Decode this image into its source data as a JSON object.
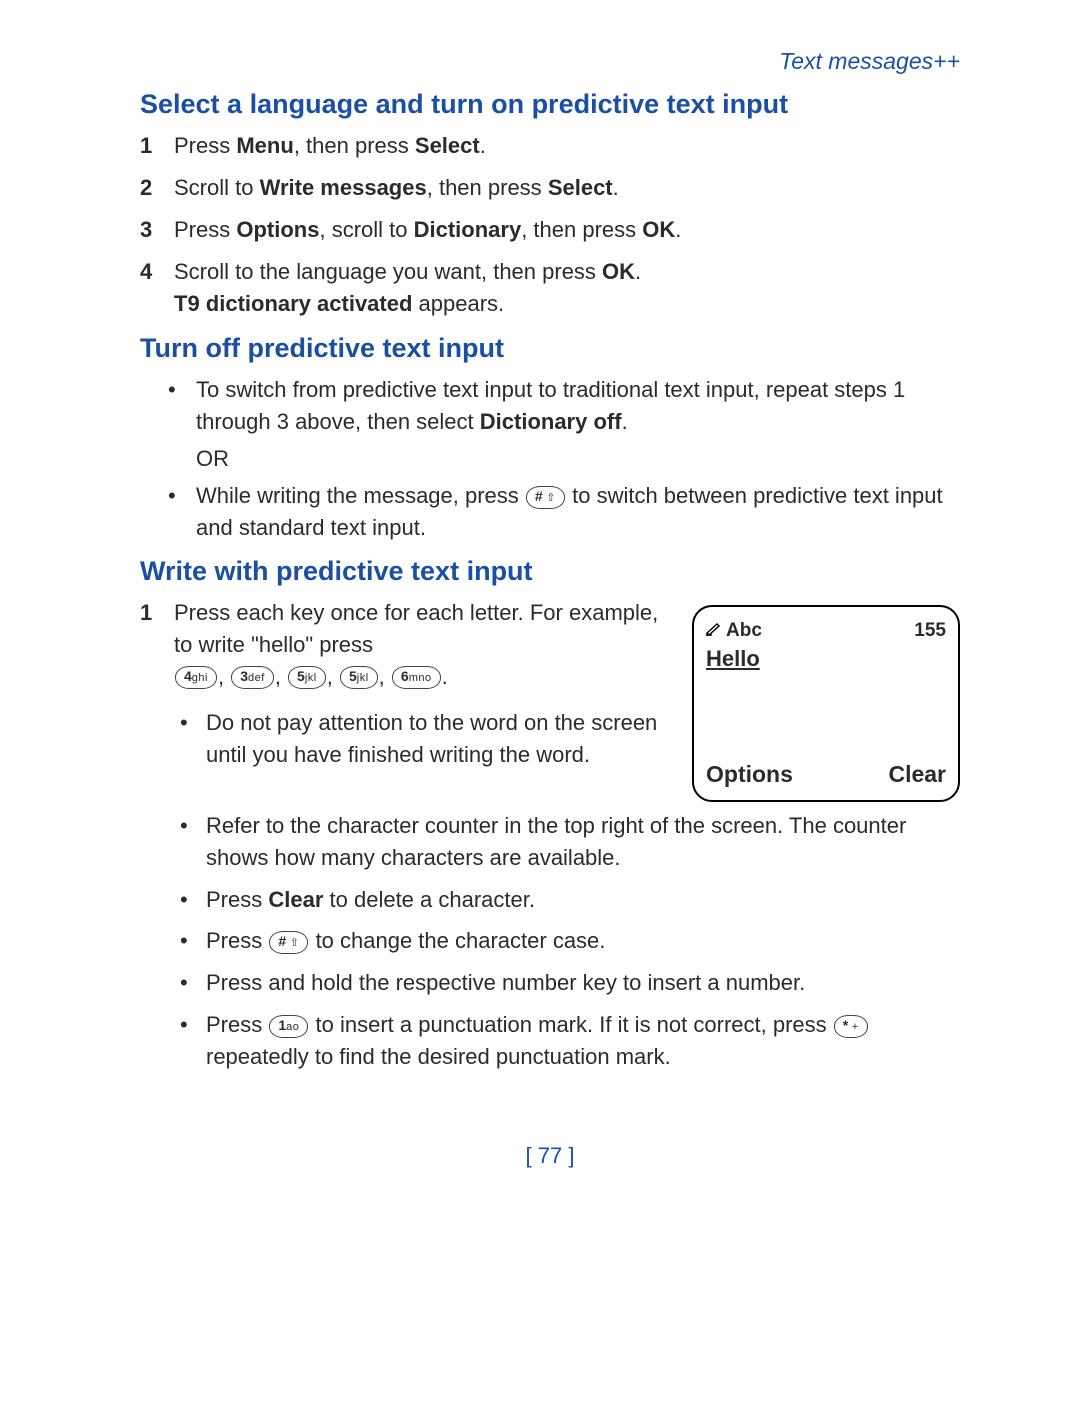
{
  "header": {
    "breadcrumb": "Text messages++"
  },
  "section1": {
    "title": "Select a language and turn on predictive text input",
    "steps": [
      {
        "num": "1",
        "pre": "Press ",
        "b1": "Menu",
        "mid": ", then press ",
        "b2": "Select",
        "post": "."
      },
      {
        "num": "2",
        "pre": "Scroll to ",
        "b1": "Write messages",
        "mid": ", then press ",
        "b2": "Select",
        "post": "."
      },
      {
        "num": "3",
        "pre": "Press ",
        "b1": "Options",
        "mid1": ", scroll to ",
        "b2": "Dictionary",
        "mid2": ", then press ",
        "b3": "OK",
        "post": "."
      },
      {
        "num": "4",
        "line1_pre": "Scroll to the language you want, then press ",
        "line1_b": "OK",
        "line1_post": ".",
        "line2_b": "T9 dictionary activated",
        "line2_post": " appears."
      }
    ]
  },
  "section2": {
    "title": "Turn off predictive text input",
    "bullet1_pre": "To switch from predictive text input to traditional text input, repeat steps 1  through  3 above, then select ",
    "bullet1_b": "Dictionary off",
    "bullet1_post": ".",
    "or": "OR",
    "bullet2_pre": "While writing the message, press ",
    "bullet2_key": {
      "n": "#",
      "l": " ⇧"
    },
    "bullet2_post": " to switch between predictive text input and standard text input."
  },
  "section3": {
    "title": "Write with predictive text input",
    "step1": {
      "num": "1",
      "intro": "Press each key once for each letter. For example, to write \"hello\" press ",
      "keys": [
        {
          "n": "4",
          "l": "ghi"
        },
        {
          "n": "3",
          "l": "def"
        },
        {
          "n": "5",
          "l": "jkl"
        },
        {
          "n": "5",
          "l": "jkl"
        },
        {
          "n": "6",
          "l": "mno"
        }
      ],
      "keys_post": "."
    },
    "nested": [
      {
        "text": "Do not pay attention to the word on the screen until you have finished writing the word."
      },
      {
        "text": "Refer to the character counter in the top right of the screen. The counter shows how many characters are available."
      },
      {
        "pre": "Press ",
        "b": "Clear",
        "post": " to delete a character."
      },
      {
        "pre": "Press  ",
        "key": {
          "n": "#",
          "l": " ⇧"
        },
        "post": "  to change the character case."
      },
      {
        "text": "Press and hold the respective number key to insert a number."
      },
      {
        "pre": "Press  ",
        "key1": {
          "n": "1",
          "l": "ao"
        },
        "mid": "  to insert a punctuation mark. If it is not correct, press ",
        "key2": {
          "n": "*",
          "l": " +"
        },
        "post": " repeatedly to find the desired punctuation mark."
      }
    ],
    "phone": {
      "mode": "Abc",
      "count": "155",
      "word": "Hello",
      "left": "Options",
      "right": "Clear"
    }
  },
  "pagenum": "[ 77 ]"
}
